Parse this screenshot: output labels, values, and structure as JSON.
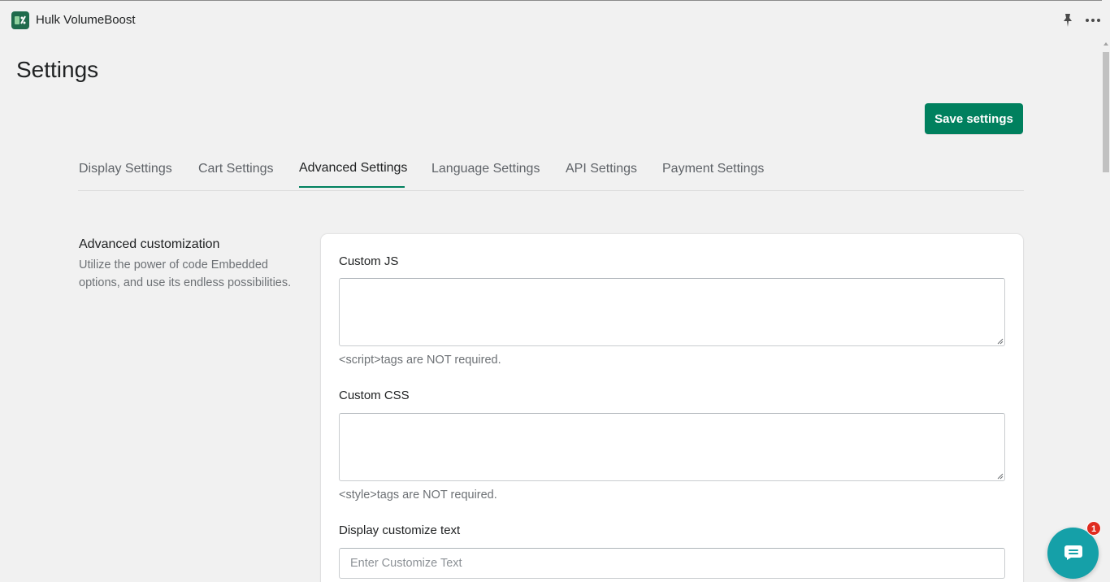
{
  "app": {
    "name": "Hulk VolumeBoost",
    "logo_icon": "app-logo-icon",
    "brand_color": "#00805e"
  },
  "page": {
    "title": "Settings",
    "save_label": "Save settings"
  },
  "tabs": [
    {
      "label": "Display Settings",
      "active": false
    },
    {
      "label": "Cart Settings",
      "active": false
    },
    {
      "label": "Advanced Settings",
      "active": true
    },
    {
      "label": "Language Settings",
      "active": false
    },
    {
      "label": "API Settings",
      "active": false
    },
    {
      "label": "Payment Settings",
      "active": false
    }
  ],
  "section": {
    "title": "Advanced customization",
    "description": "Utilize the power of code Embedded options, and use its endless possibilities."
  },
  "fields": {
    "custom_js": {
      "label": "Custom JS",
      "value": "",
      "help": "<script>tags are NOT required."
    },
    "custom_css": {
      "label": "Custom CSS",
      "value": "",
      "help": "<style>tags are NOT required."
    },
    "customize_text": {
      "label": "Display customize text",
      "value": "",
      "placeholder": "Enter Customize Text"
    }
  },
  "chat": {
    "badge_count": "1",
    "icon": "chat-icon",
    "color": "#15a0a8"
  }
}
